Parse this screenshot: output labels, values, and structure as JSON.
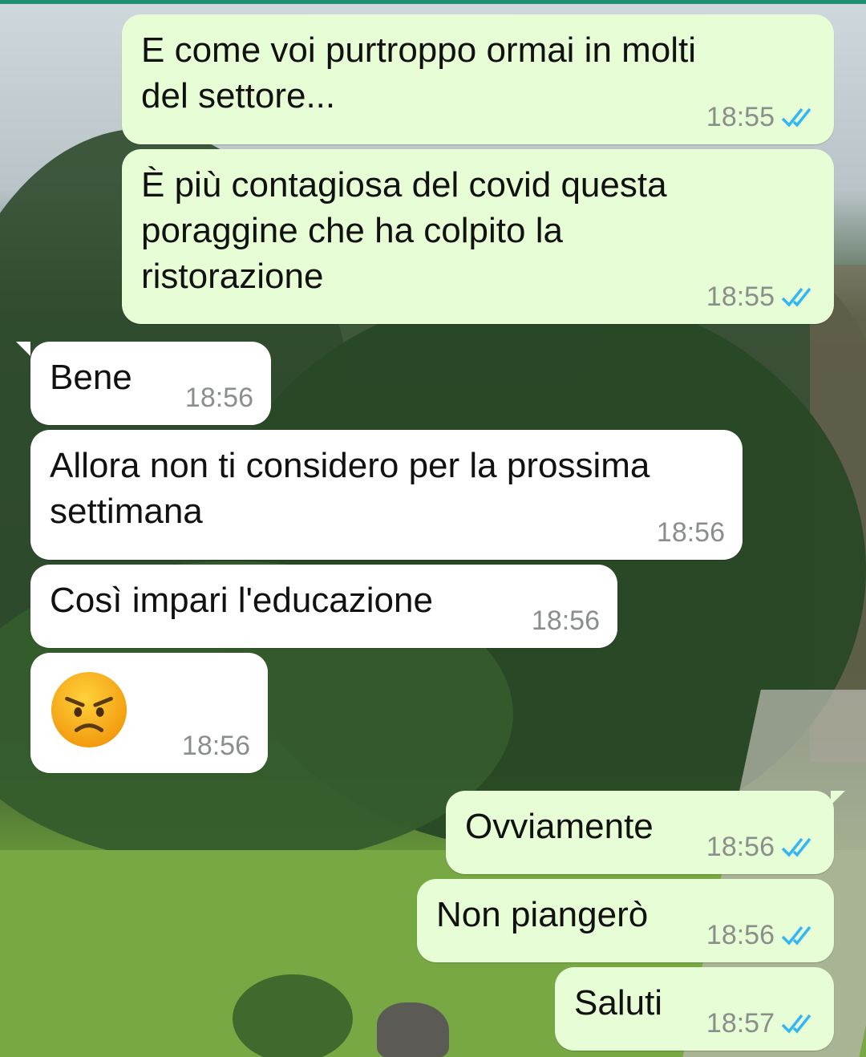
{
  "messages": [
    {
      "dir": "out",
      "lines": [
        "E come voi purtroppo ormai in molti",
        "del settore..."
      ],
      "time": "18:55",
      "status": "read"
    },
    {
      "dir": "out",
      "lines": [
        "È più contagiosa del covid questa",
        "poraggine che ha colpito la",
        "ristorazione"
      ],
      "time": "18:55",
      "status": "read"
    },
    {
      "dir": "in",
      "lines": [
        "Bene"
      ],
      "time": "18:56"
    },
    {
      "dir": "in",
      "lines": [
        "Allora non ti considero per la prossima",
        "settimana"
      ],
      "time": "18:56"
    },
    {
      "dir": "in",
      "lines": [
        "Così impari l'educazione"
      ],
      "time": "18:56"
    },
    {
      "dir": "in",
      "emoji": "angry-face",
      "time": "18:56"
    },
    {
      "dir": "out",
      "lines": [
        "Ovviamente"
      ],
      "time": "18:56",
      "status": "read"
    },
    {
      "dir": "out",
      "lines": [
        "Non piangerò"
      ],
      "time": "18:56",
      "status": "read"
    },
    {
      "dir": "out",
      "lines": [
        "Saluti"
      ],
      "time": "18:57",
      "status": "read"
    }
  ],
  "colors": {
    "outgoing_bubble": "#e7fdd6",
    "incoming_bubble": "#ffffff",
    "read_ticks": "#34b7f1",
    "timestamp": "#8a8f8c"
  },
  "icons": {
    "read_receipt": "double-check-icon",
    "emoji": "angry-face-emoji"
  }
}
